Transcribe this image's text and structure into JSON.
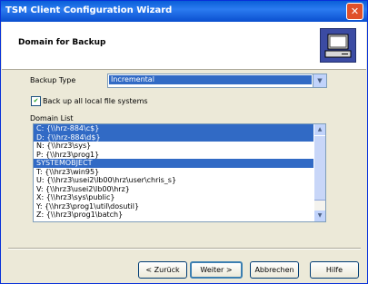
{
  "window": {
    "title": "TSM Client Configuration Wizard",
    "close_glyph": "✕"
  },
  "header": {
    "title": "Domain for Backup",
    "icon": "computer-icon"
  },
  "backup_type": {
    "label": "Backup Type",
    "value": "Incremental"
  },
  "checkbox": {
    "label": "Back up all local file systems",
    "checked": true
  },
  "domain_list": {
    "label": "Domain List",
    "items": [
      {
        "text": "C: {\\\\hrz-884\\c$}",
        "selected": true
      },
      {
        "text": "D: {\\\\hrz-884\\d$}",
        "selected": true
      },
      {
        "text": "N: {\\\\hrz3\\sys}",
        "selected": false
      },
      {
        "text": "P: {\\\\hrz3\\prog1}",
        "selected": false
      },
      {
        "text": "SYSTEMOBJECT",
        "selected": true
      },
      {
        "text": "T: {\\\\hrz3\\win95}",
        "selected": false
      },
      {
        "text": "U: {\\\\hrz3\\usei2\\lb00\\hrz\\user\\chris_s}",
        "selected": false
      },
      {
        "text": "V: {\\\\hrz3\\usei2\\lb00\\hrz}",
        "selected": false
      },
      {
        "text": "X: {\\\\hrz3\\sys\\public}",
        "selected": false
      },
      {
        "text": "Y: {\\\\hrz3\\prog1\\util\\dosutil}",
        "selected": false
      },
      {
        "text": "Z: {\\\\hrz3\\prog1\\batch}",
        "selected": false
      }
    ]
  },
  "buttons": {
    "back": "< Zurück",
    "next": "Weiter >",
    "cancel": "Abbrechen",
    "help": "Hilfe"
  }
}
